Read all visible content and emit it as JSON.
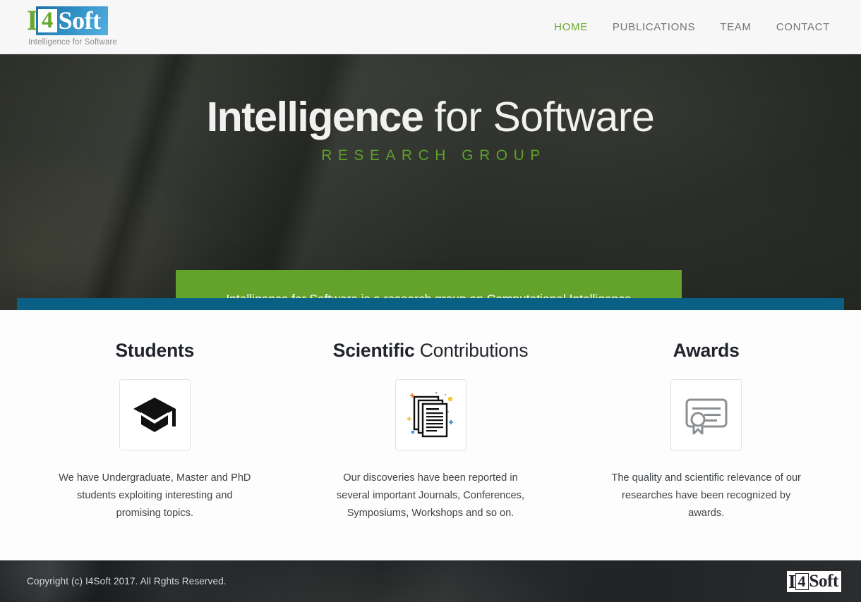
{
  "header": {
    "logo": {
      "i": "I",
      "four": "4",
      "soft": "Soft",
      "tagline": "Intelligence for Software"
    },
    "nav": [
      {
        "label": "HOME",
        "active": true
      },
      {
        "label": "PUBLICATIONS",
        "active": false
      },
      {
        "label": "TEAM",
        "active": false
      },
      {
        "label": "CONTACT",
        "active": false
      }
    ]
  },
  "hero": {
    "title_strong": "Intelligence",
    "title_light": " for Software",
    "subtitle": "RESEARCH GROUP",
    "card_text": "Intelligence for Software is a research group on Computational Intelligence approaches applied to software development challenges, specially Software Testing and Repair.",
    "card_bg": "#64a32b",
    "rule_color": "#0a5f85"
  },
  "features": [
    {
      "title_strong": "Students",
      "title_light": "",
      "icon": "graduation-cap-icon",
      "text": "We have Undergraduate, Master and PhD students exploiting interesting and promising topics."
    },
    {
      "title_strong": "Scientific",
      "title_light": " Contributions",
      "icon": "documents-stack-icon",
      "text": "Our discoveries have been reported in several important Journals, Conferences, Symposiums, Workshops and so on."
    },
    {
      "title_strong": "Awards",
      "title_light": "",
      "icon": "certificate-icon",
      "text": "The quality and scientific relevance of our researches have been recognized by awards."
    }
  ],
  "footer": {
    "copyright": "Copyright (c) I4Soft 2017. All Rghts Reserved.",
    "logo": {
      "i": "I",
      "four": "4",
      "soft": "Soft"
    }
  },
  "colors": {
    "brand_green": "#6aa82c",
    "brand_blue": "#2f8ec2",
    "hero_rule_blue": "#0a5f85",
    "nav_inactive": "#6f7375"
  }
}
